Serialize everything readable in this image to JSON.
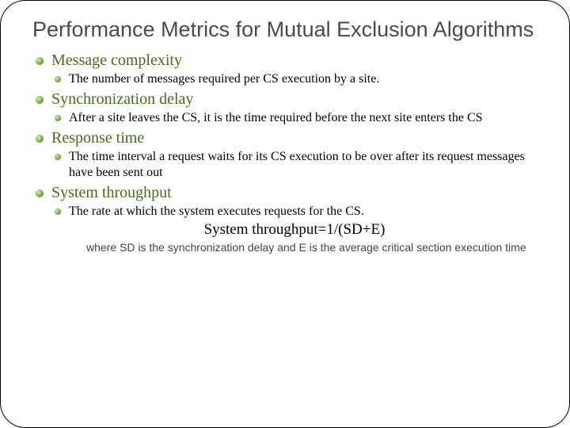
{
  "title": "Performance Metrics for Mutual Exclusion Algorithms",
  "items": [
    {
      "head": "Message complexity",
      "sub": "The number of messages required per CS execution by a site."
    },
    {
      "head": "Synchronization delay",
      "sub": "After a site leaves the CS, it is the time required before the next site enters the CS"
    },
    {
      "head": "Response time",
      "sub": "The time interval a request waits for its CS execution to be over after its request messages have been sent out"
    },
    {
      "head": "System throughput",
      "sub": "The rate at which the system executes requests for the CS."
    }
  ],
  "formula": "System throughput=1/(SD+E)",
  "note": "where SD is the synchronization delay and E is the average critical section execution time"
}
